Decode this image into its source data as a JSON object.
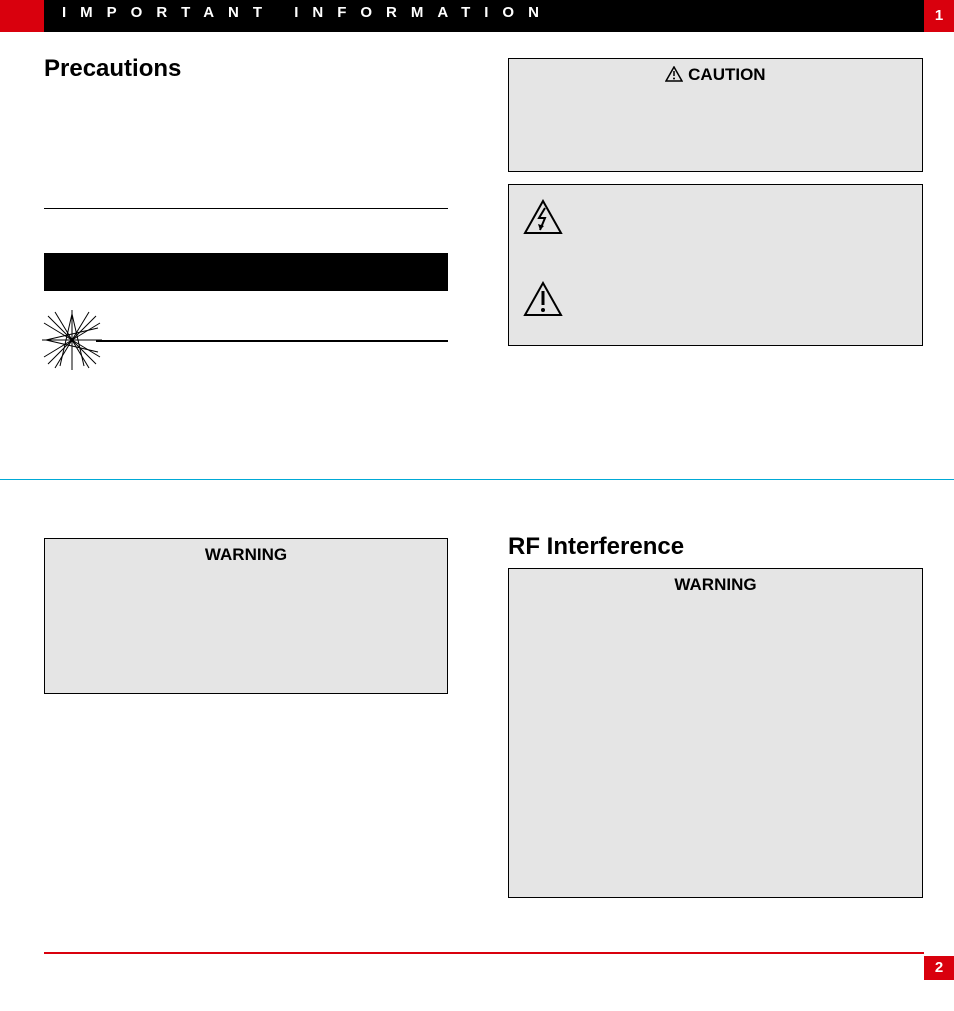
{
  "banner": {
    "title": "IMPORTANT INFORMATION",
    "top_page_num": "1"
  },
  "headings": {
    "precautions": "Precautions",
    "rf": "RF Interference"
  },
  "caution_box": {
    "label": "CAUTION"
  },
  "warning_left": {
    "label": "WARNING"
  },
  "warning_right": {
    "label": "WARNING"
  },
  "footer": {
    "page_num": "2"
  }
}
